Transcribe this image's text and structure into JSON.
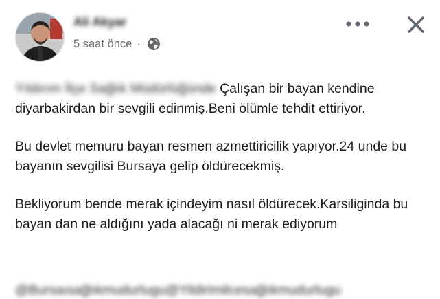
{
  "post": {
    "author_name": "Ali Akyar",
    "timestamp": "5 saat önce",
    "separator": "·",
    "privacy_icon": "globe-icon",
    "more_icon": "more-horizontal-icon",
    "close_icon": "close-icon",
    "blurred_prefix": "Yıldırım İlçe Sağlık Müdürlüğünde",
    "paragraph1_text": " Çalışan bir bayan kendine diyarbakirdan bir sevgili edinmiş.Beni ölümle tehdit ettiriyor.",
    "paragraph2": "Bu devlet memuru bayan resmen azmettiricilik yapıyor.24 unde bu bayanın sevgilisi Bursaya gelip öldürecekmiş.",
    "paragraph3": "Bekliyorum bende merak içindeyim nasıl öldürecek.Karsiliginda bu bayan dan ne aldığını yada alacağı ni merak ediyorum",
    "tags_blurred": "@Bursaısağlıkmudurlugu@Yildirimilcesağlıkmudurlugu"
  },
  "colors": {
    "text_primary": "#1c1e21",
    "text_secondary": "#65676b",
    "icon": "#606770"
  }
}
